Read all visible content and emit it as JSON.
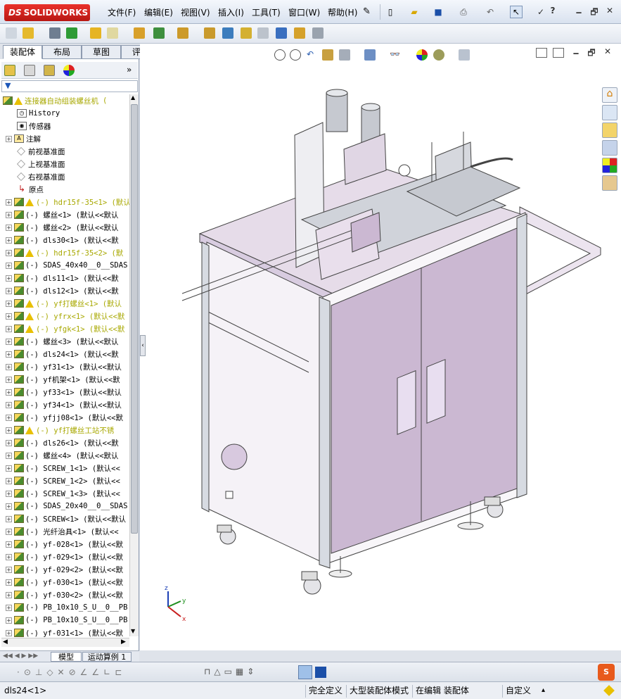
{
  "app": {
    "brand_mark": "DS",
    "brand_name": "SOLIDWORKS"
  },
  "menu": [
    "文件(F)",
    "编辑(E)",
    "视图(V)",
    "插入(I)",
    "工具(T)",
    "窗口(W)",
    "帮助(H)"
  ],
  "window_controls": {
    "minimize": "🗕",
    "restore": "🗗",
    "close": "✕",
    "help": "?"
  },
  "command_tabs": [
    "装配体",
    "布局",
    "草图",
    "评估"
  ],
  "active_command_tab": "装配体",
  "tree": {
    "root": "连接器自动组装螺丝机",
    "root_suffix": "(",
    "fixed_items": [
      "History",
      "传感器",
      "注解",
      "前视基准面",
      "上视基准面",
      "右视基准面",
      "原点"
    ],
    "components": [
      {
        "label": "(-) hdr15f-35<1> (默认",
        "warn": true
      },
      {
        "label": "(-) 螺丝<1> (默认<<默认",
        "warn": false
      },
      {
        "label": "(-) 螺丝<2> (默认<<默认",
        "warn": false
      },
      {
        "label": "(-) dls30<1> (默认<<默",
        "warn": false
      },
      {
        "label": "(-) hdr15f-35<2> (默",
        "warn": true
      },
      {
        "label": "(-) SDAS_40x40__0__SDAS",
        "warn": false
      },
      {
        "label": "(-) dls11<1> (默认<<默",
        "warn": false
      },
      {
        "label": "(-) dls12<1> (默认<<默",
        "warn": false
      },
      {
        "label": "(-) yf打螺丝<1> (默认",
        "warn": true
      },
      {
        "label": "(-) yfrx<1> (默认<<默",
        "warn": true
      },
      {
        "label": "(-) yfgk<1> (默认<<默",
        "warn": true
      },
      {
        "label": "(-) 螺丝<3> (默认<<默认",
        "warn": false
      },
      {
        "label": "(-) dls24<1> (默认<<默",
        "warn": false
      },
      {
        "label": "(-) yf31<1> (默认<<默认",
        "warn": false
      },
      {
        "label": "(-) yf机架<1> (默认<<默",
        "warn": false
      },
      {
        "label": "(-) yf33<1> (默认<<默认",
        "warn": false
      },
      {
        "label": "(-) yf34<1> (默认<<默认",
        "warn": false
      },
      {
        "label": "(-) yfjj08<1> (默认<<默",
        "warn": false
      },
      {
        "label": "(-) yf打螺丝工站不锈",
        "warn": true
      },
      {
        "label": "(-) dls26<1> (默认<<默",
        "warn": false
      },
      {
        "label": "(-) 螺丝<4> (默认<<默认",
        "warn": false
      },
      {
        "label": "(-) SCREW_1<1> (默认<<",
        "warn": false
      },
      {
        "label": "(-) SCREW_1<2> (默认<<",
        "warn": false
      },
      {
        "label": "(-) SCREW_1<3> (默认<<",
        "warn": false
      },
      {
        "label": "(-) SDAS_20x40__0__SDAS",
        "warn": false
      },
      {
        "label": "(-) SCREW<1> (默认<<默认",
        "warn": false
      },
      {
        "label": "(-) 光纤治具<1> (默认<<",
        "warn": false
      },
      {
        "label": "(-) yf-028<1> (默认<<默",
        "warn": false
      },
      {
        "label": "(-) yf-029<1> (默认<<默",
        "warn": false
      },
      {
        "label": "(-) yf-029<2> (默认<<默",
        "warn": false
      },
      {
        "label": "(-) yf-030<1> (默认<<默",
        "warn": false
      },
      {
        "label": "(-) yf-030<2> (默认<<默",
        "warn": false
      },
      {
        "label": "(-) PB_10x10_S_U__0__PB",
        "warn": false
      },
      {
        "label": "(-) PB_10x10_S_U__0__PB",
        "warn": false
      },
      {
        "label": "(-) yf-031<1> (默认<<默",
        "warn": false
      }
    ]
  },
  "bottom_tabs": [
    "模型",
    "运动算例 1"
  ],
  "status": {
    "selection": "dls24<1>",
    "definition": "完全定义",
    "mode": "大型装配体模式",
    "editing": "在编辑 装配体",
    "units": "自定义",
    "units_arrow": "▴"
  },
  "colors": {
    "accent": "#c9b7cf",
    "brand": "#c8211b",
    "warning": "#e8c000"
  }
}
